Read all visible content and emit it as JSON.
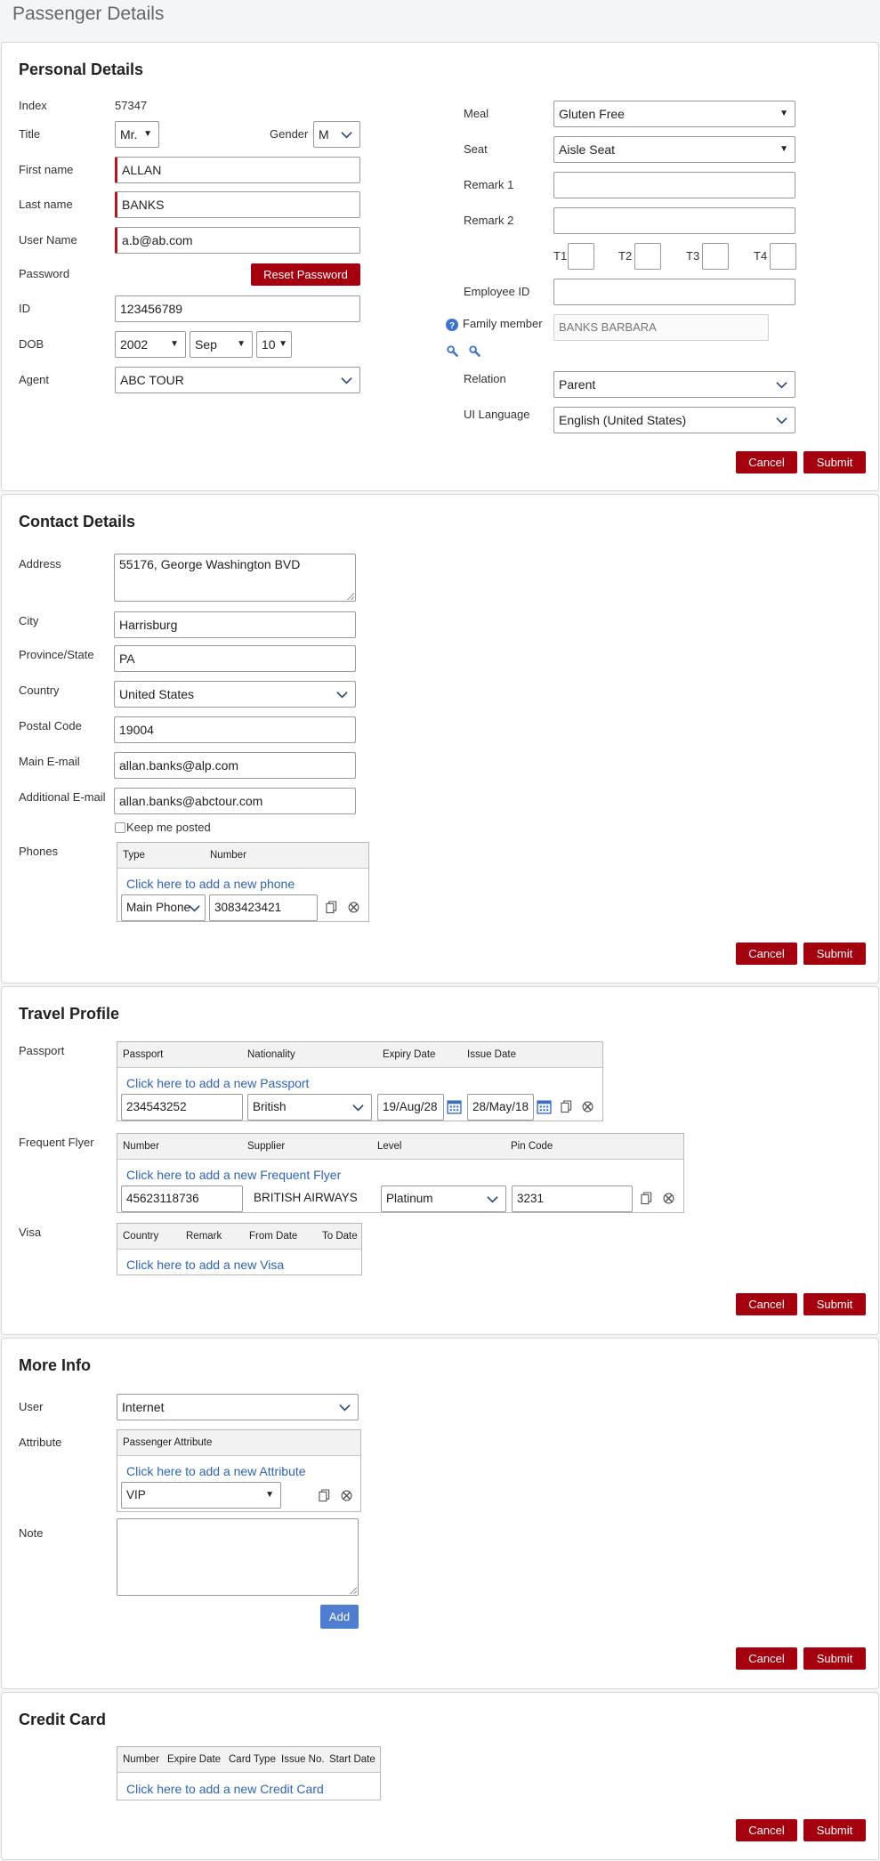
{
  "page": {
    "title": "Passenger Details"
  },
  "buttons": {
    "cancel": "Cancel",
    "submit": "Submit",
    "reset_password": "Reset Password",
    "add": "Add"
  },
  "personal": {
    "heading": "Personal Details",
    "index_label": "Index",
    "index_value": "57347",
    "title_label": "Title",
    "title_value": "Mr.",
    "gender_label": "Gender",
    "gender_value": "M",
    "first_name_label": "First name",
    "first_name_value": "ALLAN",
    "last_name_label": "Last name",
    "last_name_value": "BANKS",
    "username_label": "User Name",
    "username_value": "a.b@ab.com",
    "password_label": "Password",
    "id_label": "ID",
    "id_value": "123456789",
    "dob_label": "DOB",
    "dob_year": "2002",
    "dob_month": "Sep",
    "dob_day": "10",
    "agent_label": "Agent",
    "agent_value": "ABC TOUR",
    "meal_label": "Meal",
    "meal_value": "Gluten Free",
    "seat_label": "Seat",
    "seat_value": "Aisle Seat",
    "remark1_label": "Remark 1",
    "remark1_value": "",
    "remark2_label": "Remark 2",
    "remark2_value": "",
    "t1_label": "T1",
    "t2_label": "T2",
    "t3_label": "T3",
    "t4_label": "T4",
    "employee_id_label": "Employee ID",
    "employee_id_value": "",
    "family_label": "Family member",
    "family_value": "BANKS BARBARA",
    "relation_label": "Relation",
    "relation_value": "Parent",
    "ui_language_label": "UI Language",
    "ui_language_value": "English (United States)"
  },
  "contact": {
    "heading": "Contact Details",
    "address_label": "Address",
    "address_value": "55176, George Washington BVD",
    "city_label": "City",
    "city_value": "Harrisburg",
    "province_label": "Province/State",
    "province_value": "PA",
    "country_label": "Country",
    "country_value": "United States",
    "postal_label": "Postal Code",
    "postal_value": "19004",
    "main_email_label": "Main E-mail",
    "main_email_value": "allan.banks@alp.com",
    "add_email_label": "Additional E-mail",
    "add_email_value": "allan.banks@abctour.com",
    "keep_posted_label": "Keep me posted",
    "phones_label": "Phones",
    "phones_columns": [
      "Type",
      "Number"
    ],
    "phones_add": "Click here to add a new phone",
    "phone_type": "Main Phone",
    "phone_number": "3083423421"
  },
  "travel": {
    "heading": "Travel Profile",
    "passport_label": "Passport",
    "passport_columns": [
      "Passport",
      "Nationality",
      "Expiry Date",
      "Issue Date"
    ],
    "passport_add": "Click here to add a new Passport",
    "passport_number": "234543252",
    "passport_nationality": "British",
    "passport_expiry": "19/Aug/28",
    "passport_issue": "28/May/18",
    "ff_label": "Frequent Flyer",
    "ff_columns": [
      "Number",
      "Supplier",
      "Level",
      "Pin Code"
    ],
    "ff_add": "Click here to add a new Frequent Flyer",
    "ff_number": "45623118736",
    "ff_supplier": "BRITISH AIRWAYS",
    "ff_level": "Platinum",
    "ff_pin": "3231",
    "visa_label": "Visa",
    "visa_columns": [
      "Country",
      "Remark",
      "From Date",
      "To Date"
    ],
    "visa_add": "Click here to add a new Visa"
  },
  "more": {
    "heading": "More Info",
    "user_label": "User",
    "user_value": "Internet",
    "attribute_label": "Attribute",
    "attribute_columns": [
      "Passenger Attribute"
    ],
    "attribute_add": "Click here to add a new Attribute",
    "attribute_value": "VIP",
    "note_label": "Note",
    "note_value": ""
  },
  "credit": {
    "heading": "Credit Card",
    "columns": [
      "Number",
      "Expire Date",
      "Card Type",
      "Issue No.",
      "Start Date"
    ],
    "add": "Click here to add a new Credit Card"
  },
  "colors": {
    "primary_red": "#a5000d",
    "link_blue": "#2f64b3",
    "add_blue": "#4f7ed1"
  },
  "icons": [
    "chevron-down-icon",
    "caret-down-icon",
    "help-icon",
    "search-icon",
    "calendar-icon",
    "copy-icon",
    "delete-icon"
  ]
}
